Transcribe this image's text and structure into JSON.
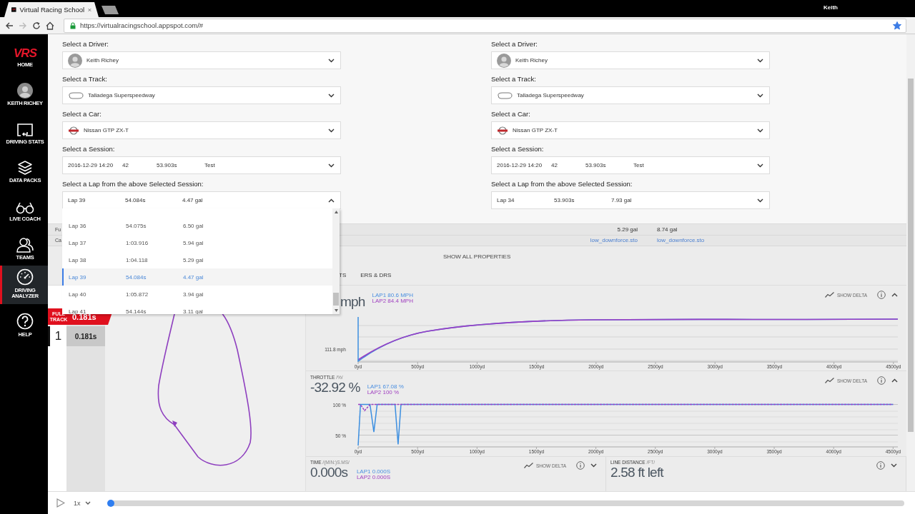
{
  "browser": {
    "tab": {
      "title": "Virtual Racing School",
      "selected": true
    },
    "user": "Keith",
    "url": "https://virtualracingschool.appspot.com/#",
    "bookmarked": true
  },
  "sidebar": {
    "items": [
      {
        "kind": "logo",
        "logo": "VRS",
        "label": "HOME",
        "selected": false
      },
      {
        "kind": "avatar",
        "label": "KEITH RICHEY",
        "selected": false
      },
      {
        "kind": "stats",
        "label": "DRIVING STATS",
        "selected": false
      },
      {
        "kind": "packs",
        "label": "DATA PACKS",
        "selected": false
      },
      {
        "kind": "coach",
        "label": "LIVE COACH",
        "selected": false
      },
      {
        "kind": "teams",
        "label": "TEAMS",
        "selected": false
      },
      {
        "kind": "analyzer",
        "label": "DRIVING ANALYZER",
        "selected": true
      },
      {
        "kind": "help",
        "label": "HELP",
        "selected": false
      }
    ]
  },
  "selectors": [
    {
      "fields": [
        {
          "kind": "driver",
          "label": "Select a Driver:",
          "cells": [
            "Keith Richey"
          ],
          "expanded": false
        },
        {
          "kind": "track",
          "label": "Select a Track:",
          "cells": [
            "Talladega Superspeedway"
          ],
          "expanded": false
        },
        {
          "kind": "car",
          "label": "Select a Car:",
          "cells": [
            "Nissan GTP ZX-T"
          ],
          "expanded": false
        },
        {
          "kind": "session",
          "label": "Select a Session:",
          "cells": [
            "2016-12-29 14:20",
            "42",
            "53.903s",
            "Test"
          ],
          "expanded": false
        },
        {
          "kind": "lap",
          "label": "Select a Lap from the above Selected Session:",
          "cells": [
            "Lap 39",
            "54.084s",
            "4.47 gal"
          ],
          "expanded": true,
          "menu": [
            {
              "cells": [
                "Lap 36",
                "54.075s",
                "6.50 gal"
              ],
              "selected": false
            },
            {
              "cells": [
                "Lap 37",
                "1:03.916",
                "5.94 gal"
              ],
              "selected": false
            },
            {
              "cells": [
                "Lap 38",
                "1:04.118",
                "5.29 gal"
              ],
              "selected": false
            },
            {
              "cells": [
                "Lap 39",
                "54.084s",
                "4.47 gal"
              ],
              "selected": true
            },
            {
              "cells": [
                "Lap 40",
                "1:05.872",
                "3.94 gal"
              ],
              "selected": false
            },
            {
              "cells": [
                "Lap 41",
                "54.144s",
                "3.11 gal"
              ],
              "selected": false
            }
          ]
        }
      ]
    },
    {
      "fields": [
        {
          "kind": "driver",
          "label": "Select a Driver:",
          "cells": [
            "Keith Richey"
          ],
          "expanded": false
        },
        {
          "kind": "track",
          "label": "Select a Track:",
          "cells": [
            "Talladega Superspeedway"
          ],
          "expanded": false
        },
        {
          "kind": "car",
          "label": "Select a Car:",
          "cells": [
            "Nissan GTP ZX-T"
          ],
          "expanded": false
        },
        {
          "kind": "session",
          "label": "Select a Session:",
          "cells": [
            "2016-12-29 14:20",
            "42",
            "53.903s",
            "Test"
          ],
          "expanded": false
        },
        {
          "kind": "lap",
          "label": "Select a Lap from the above Selected Session:",
          "cells": [
            "Lap 34",
            "53.903s",
            "7.93 gal"
          ],
          "expanded": false
        }
      ]
    }
  ],
  "properties": [
    {
      "label": "Fu",
      "kind": "text",
      "values": [
        "5.29 gal",
        "8.74 gal"
      ]
    },
    {
      "label": "Ca",
      "kind": "link",
      "values": [
        "low_downforce.sto",
        "low_downforce.sto"
      ]
    }
  ],
  "show_all_properties": "SHOW ALL PROPERTIES",
  "tabs": [
    {
      "label": "TS",
      "selected": false
    },
    {
      "label": "ERS & DRS",
      "selected": false
    }
  ],
  "sectors": {
    "badge": "FULL TRACK",
    "total": "0.181s",
    "rows": [
      {
        "number": "1",
        "time": "0.181s",
        "selected": true
      }
    ]
  },
  "speed": {
    "value": "mph",
    "lap1": "LAP1 80.6 MPH",
    "lap2": "LAP2 84.4 MPH",
    "delta": "SHOW DELTA",
    "expanded": true,
    "y_label": "111.8 mph",
    "x_labels": [
      "0yd",
      "500yd",
      "1000yd",
      "1500yd",
      "2000yd",
      "2500yd",
      "3000yd",
      "3500yd",
      "4000yd",
      "4500yd"
    ]
  },
  "throttle": {
    "title": "THROTTLE",
    "unit": "/%/",
    "value": "-32.92 %",
    "lap1": "67.08 %",
    "lap2": "100 %",
    "delta": "SHOW DELTA",
    "expanded": true,
    "chart_data": {
      "type": "line",
      "x": [
        0,
        20,
        54,
        100,
        132,
        160,
        310,
        336,
        360,
        4500
      ],
      "series": [
        {
          "name": "LAP1",
          "color": "#3d8fe0",
          "line_style": "solid",
          "values": [
            33,
            100,
            100,
            100,
            55,
            100,
            100,
            35,
            100,
            100
          ]
        },
        {
          "name": "LAP2",
          "color": "#9b3fc4",
          "line_style": "dashed",
          "values": [
            100,
            100,
            90,
            100,
            100,
            100,
            100,
            100,
            100,
            100
          ]
        }
      ],
      "xlim": [
        0,
        4540
      ],
      "ylim": [
        32,
        103
      ],
      "xticks": [
        {
          "value": 0,
          "label": "0yd"
        },
        {
          "value": 500,
          "label": "500yd"
        },
        {
          "value": 1000,
          "label": "1000yd"
        },
        {
          "value": 1500,
          "label": "1500yd"
        },
        {
          "value": 2000,
          "label": "2000yd"
        },
        {
          "value": 2500,
          "label": "2500yd"
        },
        {
          "value": 3000,
          "label": "3000yd"
        },
        {
          "value": 3500,
          "label": "3500yd"
        },
        {
          "value": 4000,
          "label": "4000yd"
        },
        {
          "value": 4500,
          "label": "4500yd"
        }
      ],
      "yticks": [
        {
          "value": 100,
          "label": "100 %"
        },
        {
          "value": 50,
          "label": "50 %"
        }
      ]
    }
  },
  "time": {
    "title": "TIME",
    "unit": "/(MIN:)S.MS/",
    "value": "0.000s",
    "lap1": "LAP1 0.000S",
    "lap2": "LAP2 0.000S",
    "delta": "SHOW DELTA",
    "expanded": false
  },
  "line_distance": {
    "title": "LINE DISTANCE",
    "unit": "/FT/",
    "value": "2.58 ft left",
    "expanded": false
  },
  "playback": {
    "playing": false,
    "speed": "1x",
    "level": 0
  }
}
